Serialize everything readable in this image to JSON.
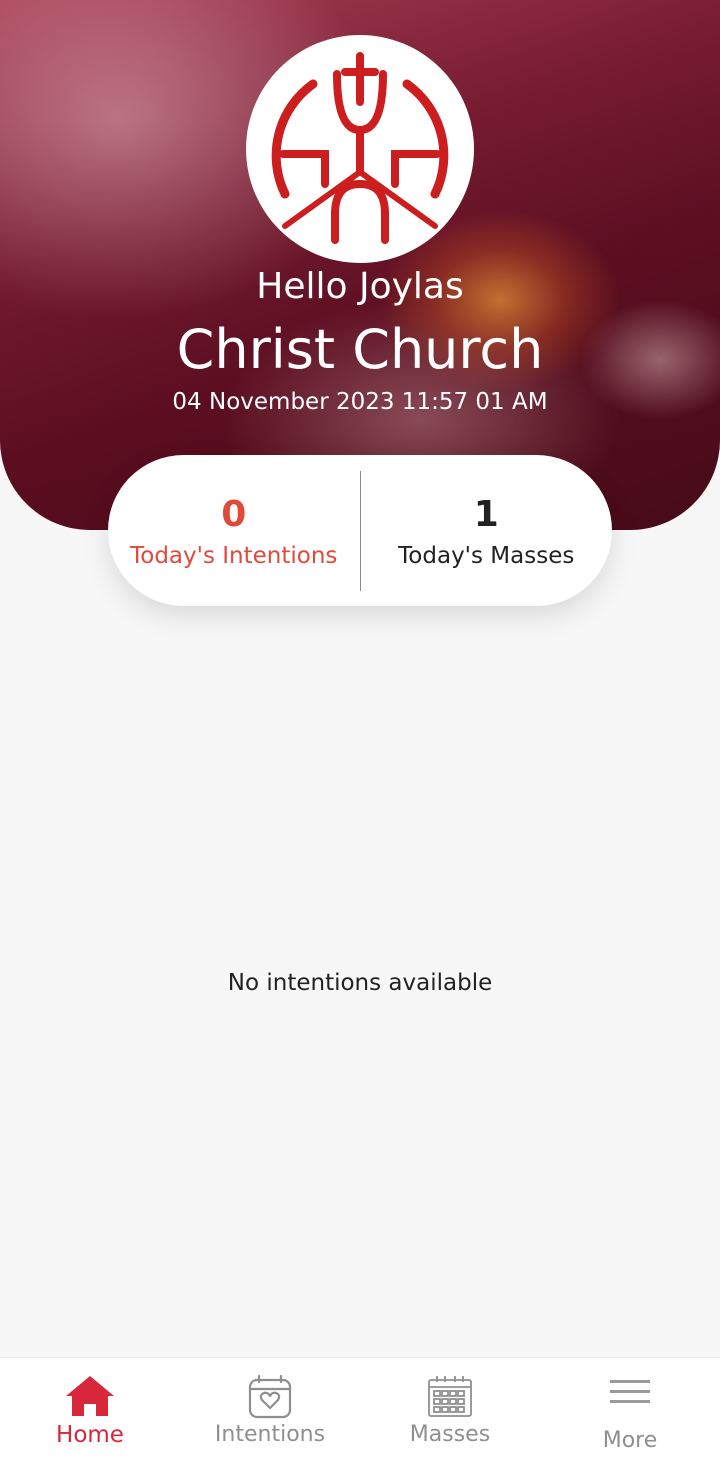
{
  "header": {
    "greeting": "Hello Joylas",
    "church_name": "Christ Church",
    "datetime": "04 November 2023 11:57 01 AM"
  },
  "stats": {
    "intentions": {
      "count": "0",
      "label": "Today's Intentions"
    },
    "masses": {
      "count": "1",
      "label": "Today's Masses"
    }
  },
  "content": {
    "empty_message": "No intentions available"
  },
  "bottom_nav": {
    "items": [
      {
        "label": "Home",
        "icon": "home-icon",
        "active": true
      },
      {
        "label": "Intentions",
        "icon": "calendar-heart-icon",
        "active": false
      },
      {
        "label": "Masses",
        "icon": "calendar-grid-icon",
        "active": false
      },
      {
        "label": "More",
        "icon": "menu-icon",
        "active": false
      }
    ]
  },
  "colors": {
    "accent": "#d8273a",
    "intentions": "#e04a3a",
    "logo_red": "#cc1e1e",
    "inactive": "#8f8f8f"
  }
}
